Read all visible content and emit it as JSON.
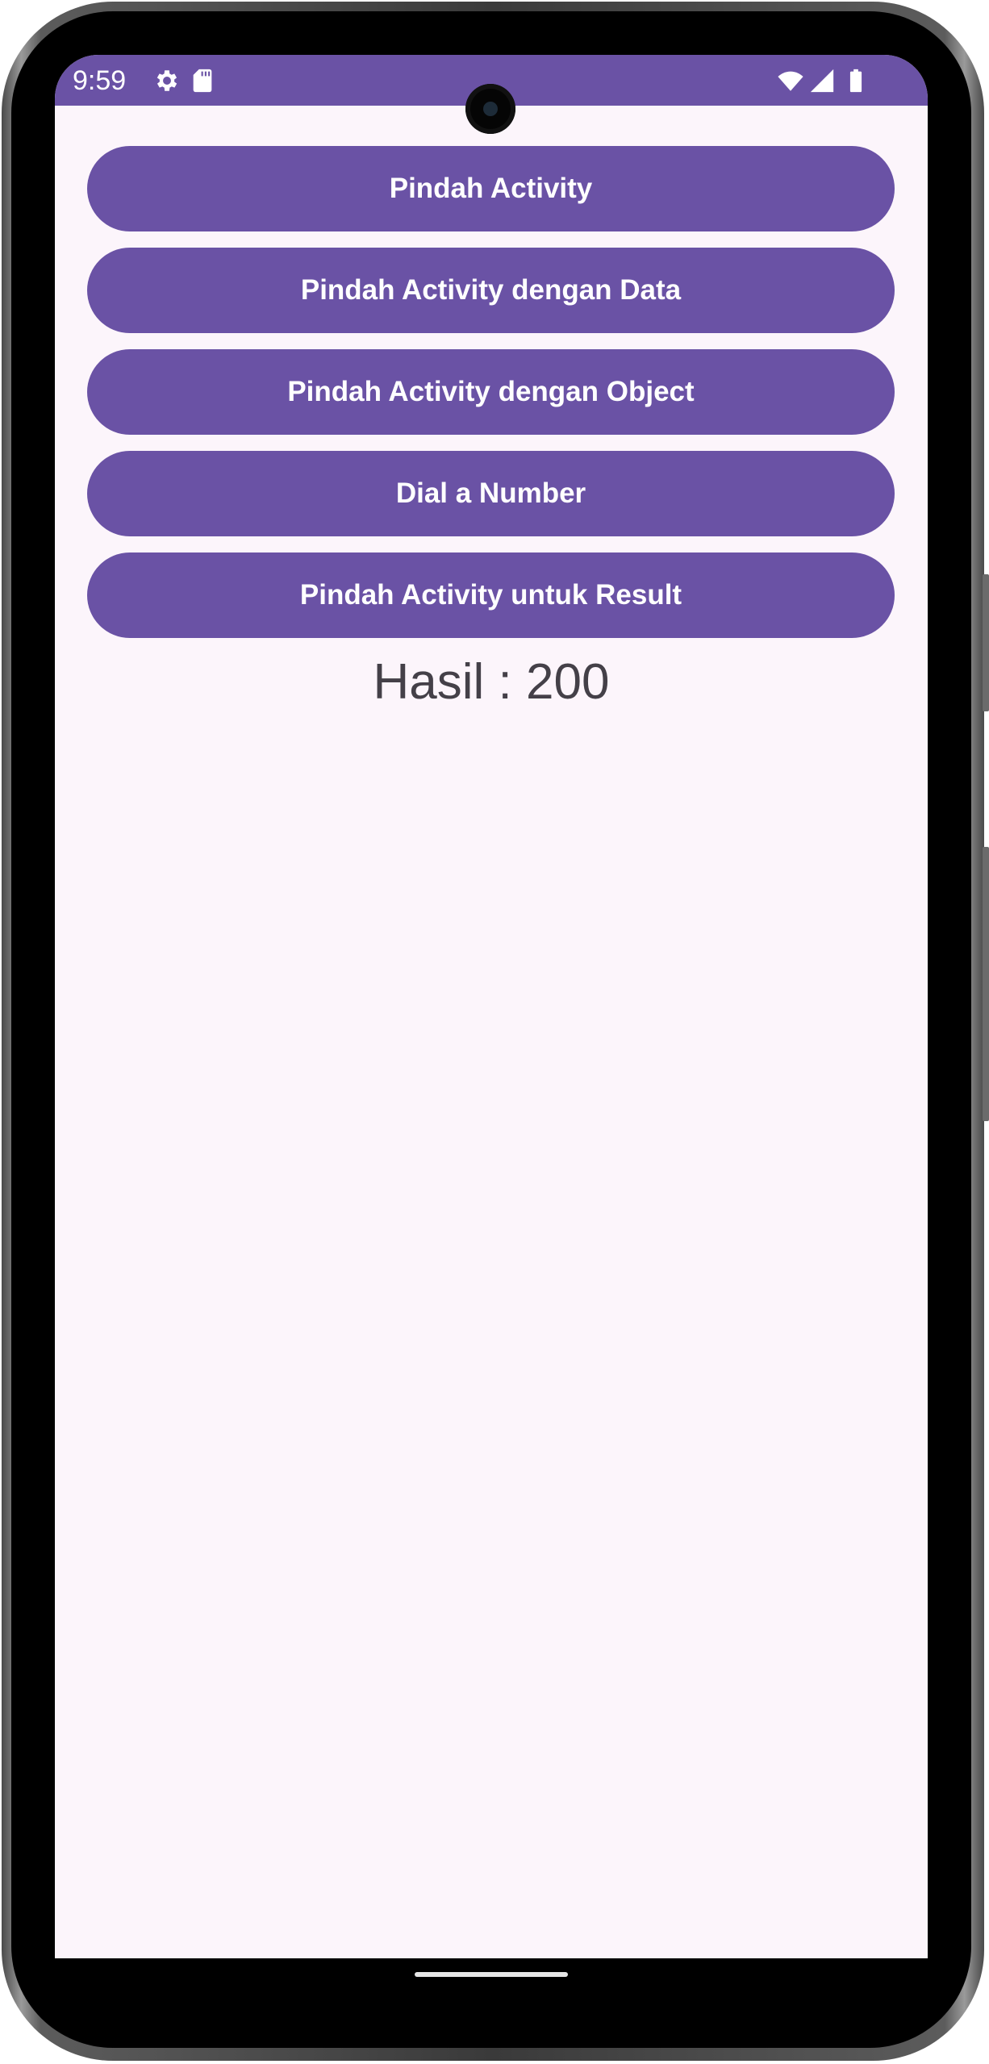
{
  "status_bar": {
    "time": "9:59",
    "background_color": "#6a52a5",
    "icons_left": [
      "gear-icon",
      "sd-card-icon"
    ],
    "icons_right": [
      "wifi-icon",
      "signal-icon",
      "battery-icon"
    ]
  },
  "buttons": [
    {
      "label": "Pindah Activity"
    },
    {
      "label": "Pindah Activity dengan Data"
    },
    {
      "label": "Pindah Activity dengan Object"
    },
    {
      "label": "Dial a Number"
    },
    {
      "label": "Pindah Activity untuk Result"
    }
  ],
  "result": {
    "text": "Hasil : 200"
  },
  "theme": {
    "accent": "#6a52a5",
    "screen_background": "#fcf5fb",
    "result_text_color": "#444048"
  }
}
